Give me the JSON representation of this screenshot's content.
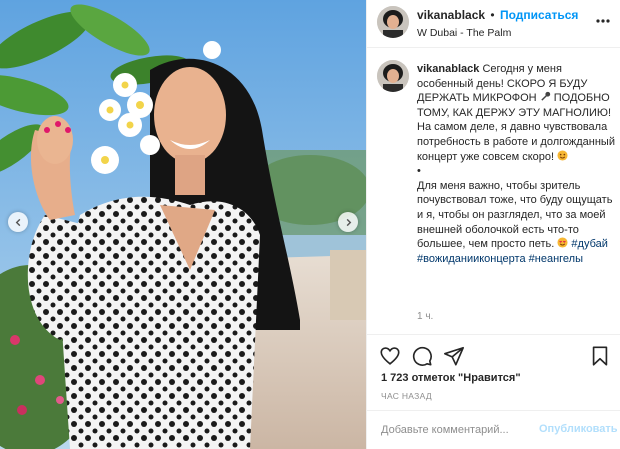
{
  "post": {
    "username": "vikanablack",
    "separator": "•",
    "follow_label": "Подписаться",
    "location": "W Dubai - The Palm",
    "caption": {
      "p1": "Сегодня у меня особенный день! СКОРО Я БУДУ ДЕРЖАТЬ МИКРОФОН",
      "p1_tail": "ПОДОБНО ТОМУ, КАК ДЕРЖУ ЭТУ МАГНОЛИЮ!",
      "p2": "На самом деле, я давно чувствовала потребность в работе и долгожданный концерт уже совсем скоро!",
      "p3": "•",
      "p4": "Для меня важно, чтобы зритель почувствовал тоже, что буду ощущать и я, чтобы он разглядел, что за моей внешней оболочкой есть что-то большее, чем просто петь.",
      "tags": [
        "#дубай",
        "#вожиданииконцерта",
        "#неангелы"
      ]
    },
    "time_ago": "1 ч.",
    "likes_text": "1 723 отметок \"Нравится\"",
    "date_label": "ЧАС НАЗАД",
    "comment_placeholder": "Добавьте комментарий...",
    "publish_label": "Опубликовать"
  },
  "icons": {
    "more": "more-horizontal-icon",
    "like": "heart-icon",
    "comment": "comment-icon",
    "share": "paper-plane-icon",
    "save": "bookmark-icon",
    "prev": "chevron-left-icon",
    "next": "chevron-right-icon",
    "mic": "microphone-emoji",
    "smile": "smiling-face-emoji",
    "heart_eyes": "heart-eyes-emoji"
  },
  "colors": {
    "accent": "#0095f6",
    "hashtag": "#00376b",
    "muted": "#8e8e8e",
    "publish_disabled": "#b2dffc"
  }
}
